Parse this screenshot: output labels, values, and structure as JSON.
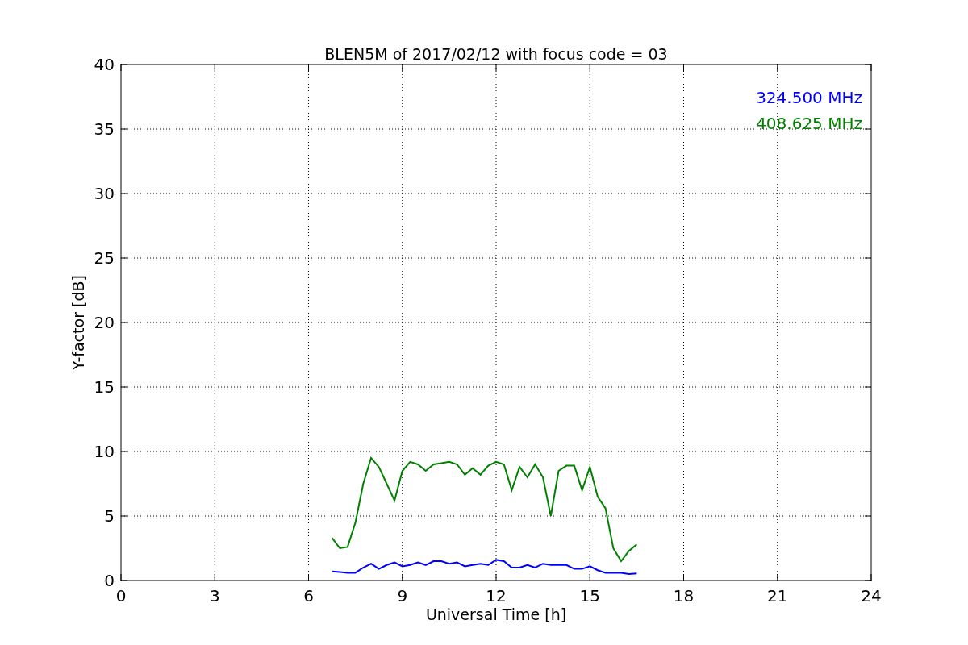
{
  "chart_data": {
    "type": "line",
    "title": "BLEN5M of 2017/02/12 with focus code = 03",
    "xlabel": "Universal Time [h]",
    "ylabel": "Y-factor [dB]",
    "x": [
      6.75,
      7.0,
      7.25,
      7.5,
      7.75,
      8.0,
      8.25,
      8.5,
      8.75,
      9.0,
      9.25,
      9.5,
      9.75,
      10.0,
      10.25,
      10.5,
      10.75,
      11.0,
      11.25,
      11.5,
      11.75,
      12.0,
      12.25,
      12.5,
      12.75,
      13.0,
      13.25,
      13.5,
      13.75,
      14.0,
      14.25,
      14.5,
      14.75,
      15.0,
      15.25,
      15.5,
      15.75,
      16.0,
      16.25,
      16.5
    ],
    "series": [
      {
        "name": "324.500 MHz",
        "color": "#0000ff",
        "values": [
          0.7,
          0.65,
          0.6,
          0.6,
          1.0,
          1.3,
          0.9,
          1.2,
          1.4,
          1.1,
          1.2,
          1.4,
          1.2,
          1.5,
          1.5,
          1.3,
          1.4,
          1.1,
          1.2,
          1.3,
          1.2,
          1.6,
          1.5,
          1.0,
          1.0,
          1.2,
          1.0,
          1.3,
          1.2,
          1.2,
          1.2,
          0.9,
          0.9,
          1.1,
          0.8,
          0.6,
          0.6,
          0.6,
          0.5,
          0.55
        ]
      },
      {
        "name": "408.625 MHz",
        "color": "#008000",
        "values": [
          3.3,
          2.5,
          2.6,
          4.5,
          7.5,
          9.5,
          8.8,
          7.5,
          6.2,
          8.5,
          9.2,
          9.0,
          8.5,
          9.0,
          9.1,
          9.2,
          9.0,
          8.2,
          8.7,
          8.2,
          8.9,
          9.2,
          9.0,
          7.0,
          8.8,
          8.0,
          9.0,
          8.0,
          5.0,
          8.5,
          8.9,
          8.9,
          7.0,
          8.8,
          6.5,
          5.6,
          2.5,
          1.5,
          2.3,
          2.8
        ]
      }
    ],
    "xlim": [
      0,
      24
    ],
    "ylim": [
      0,
      40
    ],
    "xticks": [
      0,
      3,
      6,
      9,
      12,
      15,
      18,
      21,
      24
    ],
    "yticks": [
      0,
      5,
      10,
      15,
      20,
      25,
      30,
      35,
      40
    ],
    "grid": true
  }
}
